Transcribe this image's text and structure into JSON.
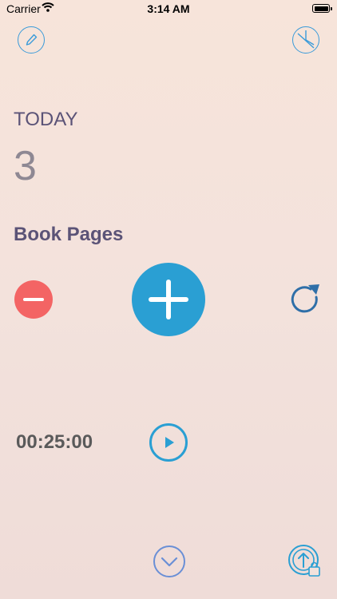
{
  "status_bar": {
    "carrier": "Carrier",
    "time": "3:14 AM"
  },
  "header": {
    "edit_icon": "pencil-icon",
    "stats_icon": "pie-chart-icon"
  },
  "main": {
    "period_label": "TODAY",
    "count": "3",
    "category": "Book Pages"
  },
  "controls": {
    "decrement_icon": "minus-icon",
    "increment_icon": "plus-icon",
    "reset_icon": "refresh-icon"
  },
  "timer": {
    "value": "00:25:00",
    "play_icon": "play-icon"
  },
  "footer": {
    "collapse_icon": "chevron-down-icon",
    "upgrade_icon": "upload-bag-icon"
  },
  "colors": {
    "accent": "#2a9fd3",
    "danger": "#f36464",
    "text": "#5b5377"
  }
}
